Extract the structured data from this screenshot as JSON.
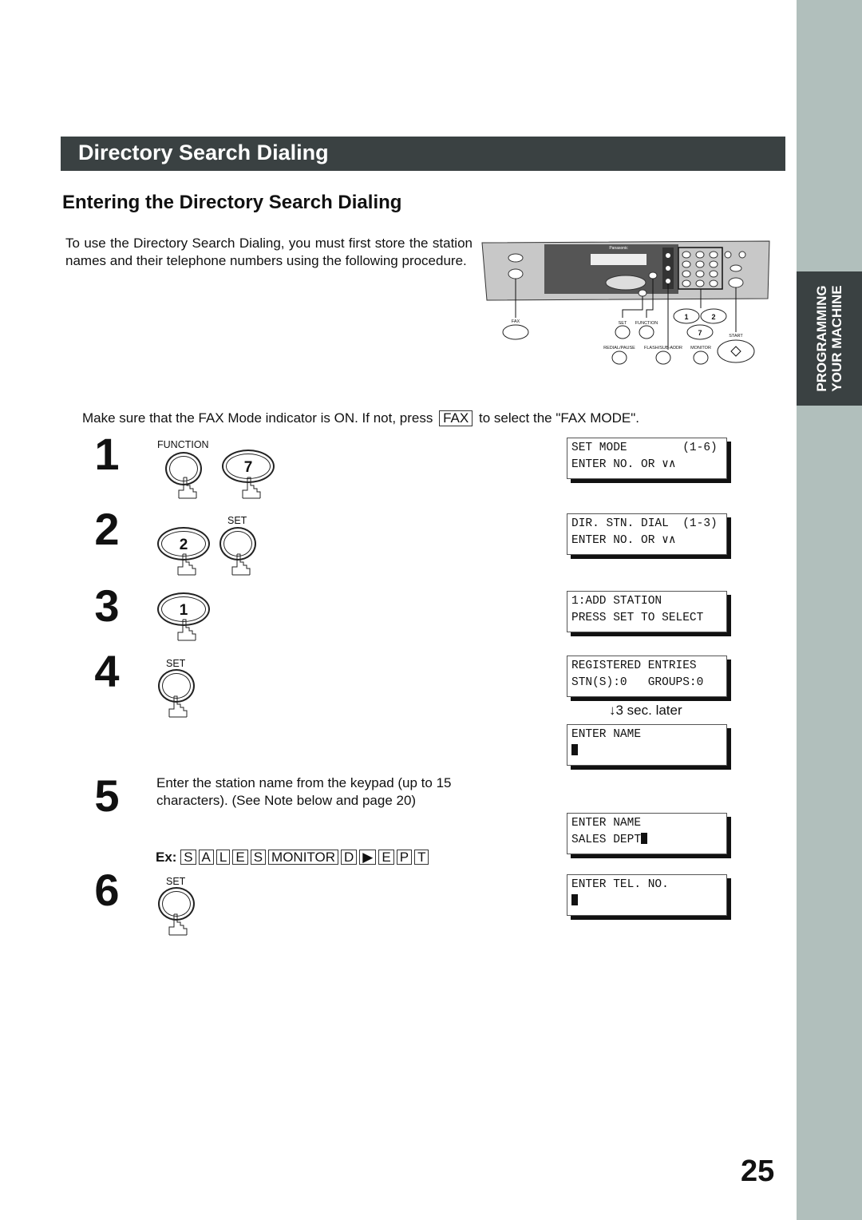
{
  "section_title": "Directory Search Dialing",
  "side_tab": {
    "line1": "PROGRAMMING",
    "line2": "YOUR MACHINE"
  },
  "heading": "Entering the Directory Search Dialing",
  "intro": "To use the Directory Search Dialing, you must first store the station names and their telephone numbers using the following procedure.",
  "panel": {
    "brand": "Panasonic",
    "labels": {
      "fax": "FAX",
      "set": "SET",
      "function": "FUNCTION",
      "start": "START",
      "redial": "REDIAL/PAUSE",
      "flash": "FLASH/SUB-ADDR",
      "monitor": "MONITOR"
    },
    "keys": [
      "1",
      "2",
      "7"
    ]
  },
  "fax_mode": {
    "before": "Make sure that the FAX Mode indicator is ON.  If not, press",
    "key": "FAX",
    "after": "to select the \"FAX MODE\"."
  },
  "steps": [
    {
      "num": "1",
      "buttons": [
        {
          "label": "FUNCTION",
          "key": ""
        },
        {
          "label": "",
          "key": "7"
        }
      ],
      "lcd": [
        "SET MODE        (1-6)",
        "ENTER NO. OR ∨∧"
      ]
    },
    {
      "num": "2",
      "buttons": [
        {
          "label": "",
          "key": "2"
        },
        {
          "label": "SET",
          "key": ""
        }
      ],
      "lcd": [
        "DIR. STN. DIAL  (1-3)",
        "ENTER NO. OR ∨∧"
      ]
    },
    {
      "num": "3",
      "buttons": [
        {
          "label": "",
          "key": "1"
        }
      ],
      "lcd": [
        "1:ADD STATION",
        "PRESS SET TO SELECT"
      ]
    },
    {
      "num": "4",
      "buttons": [
        {
          "label": "SET",
          "key": ""
        }
      ],
      "lcd": [
        "REGISTERED ENTRIES",
        "STN(S):0   GROUPS:0"
      ],
      "later": "↓3 sec. later",
      "lcd2": [
        "ENTER NAME",
        ""
      ]
    },
    {
      "num": "5",
      "text": "Enter the station name from the keypad (up to 15 characters). (See Note below and page 20)",
      "example_label": "Ex:",
      "example_keys": [
        "S",
        "A",
        "L",
        "E",
        "S",
        "MONITOR",
        "D",
        "▶",
        "E",
        "P",
        "T"
      ],
      "lcd": [
        "ENTER NAME",
        "SALES DEPT"
      ]
    },
    {
      "num": "6",
      "buttons": [
        {
          "label": "SET",
          "key": ""
        }
      ],
      "lcd": [
        "ENTER TEL. NO.",
        ""
      ]
    }
  ],
  "page_number": "25"
}
